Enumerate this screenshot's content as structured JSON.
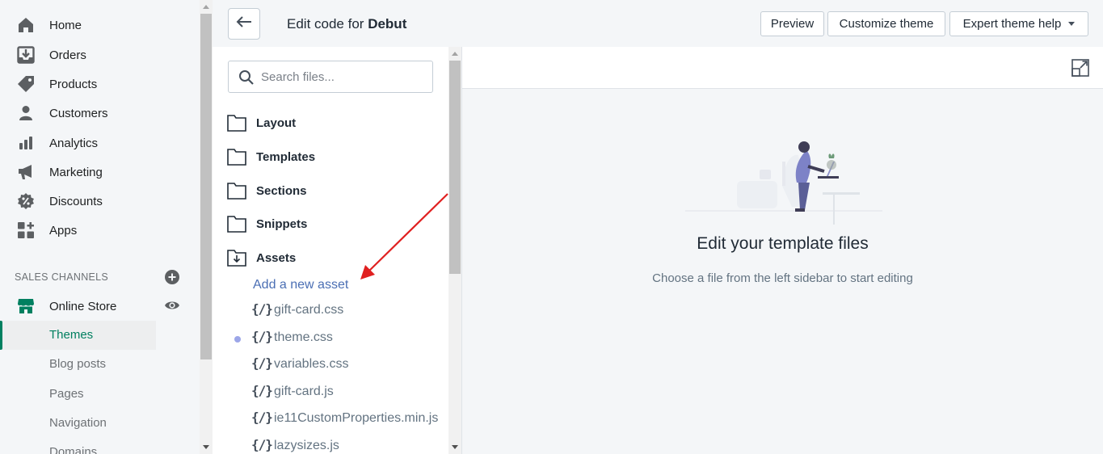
{
  "nav": {
    "items": [
      {
        "label": "Home",
        "icon": "home-icon"
      },
      {
        "label": "Orders",
        "icon": "orders-icon"
      },
      {
        "label": "Products",
        "icon": "tag-icon"
      },
      {
        "label": "Customers",
        "icon": "person-icon"
      },
      {
        "label": "Analytics",
        "icon": "bar-chart-icon"
      },
      {
        "label": "Marketing",
        "icon": "megaphone-icon"
      },
      {
        "label": "Discounts",
        "icon": "discount-icon"
      },
      {
        "label": "Apps",
        "icon": "apps-icon"
      }
    ],
    "channels_heading": "SALES CHANNELS",
    "online_store": "Online Store",
    "sub_items": [
      {
        "label": "Themes",
        "active": true
      },
      {
        "label": "Blog posts"
      },
      {
        "label": "Pages"
      },
      {
        "label": "Navigation"
      },
      {
        "label": "Domains"
      }
    ],
    "accent_color": "#008060"
  },
  "header": {
    "title_prefix": "Edit code for",
    "theme_name": "Debut",
    "preview_label": "Preview",
    "customize_label": "Customize theme",
    "expert_label": "Expert theme help"
  },
  "files": {
    "search_placeholder": "Search files...",
    "folders": [
      "Layout",
      "Templates",
      "Sections",
      "Snippets",
      "Assets"
    ],
    "add_asset": "Add a new asset",
    "bracket_glyph": "{/}",
    "assets": [
      {
        "name": "gift-card.css",
        "modified": false
      },
      {
        "name": "theme.css",
        "modified": true
      },
      {
        "name": "variables.css",
        "modified": false
      },
      {
        "name": "gift-card.js",
        "modified": false
      },
      {
        "name": "ie11CustomProperties.min.js",
        "modified": false
      },
      {
        "name": "lazysizes.js",
        "modified": false
      }
    ]
  },
  "editor": {
    "empty_title": "Edit your template files",
    "empty_subtitle": "Choose a file from the left sidebar to start editing"
  },
  "annotation": {
    "color": "#e02020"
  }
}
